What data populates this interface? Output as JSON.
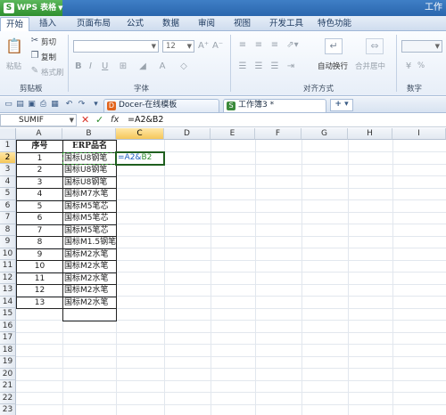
{
  "titlebar": {
    "app_name": "WPS 表格",
    "logo": "S",
    "doc_title": "工作"
  },
  "tabs": [
    "开始",
    "插入",
    "页面布局",
    "公式",
    "数据",
    "审阅",
    "视图",
    "开发工具",
    "特色功能"
  ],
  "ribbon": {
    "paste": "粘贴",
    "cut": "剪切",
    "copy": "复制",
    "format_painter": "格式刷",
    "clipboard_group": "剪贴板",
    "font_size": "12",
    "bold": "B",
    "italic": "I",
    "underline": "U",
    "font_group": "字体",
    "wrap_text": "自动换行",
    "merge_center": "合并居中",
    "align_group": "对齐方式",
    "percent": "%",
    "number_group": "数字"
  },
  "doc_tabs": [
    {
      "label": "Docer-在线模板",
      "active": false
    },
    {
      "label": "工作簿3 *",
      "active": true
    }
  ],
  "formula_bar": {
    "name_box": "SUMIF",
    "cancel": "✕",
    "confirm": "✓",
    "fx": "fx",
    "formula": "=A2&B2"
  },
  "sheet": {
    "columns": [
      "A",
      "B",
      "C",
      "D",
      "E",
      "F",
      "G",
      "H",
      "I"
    ],
    "selected_column": "C",
    "rows": [
      "1",
      "2",
      "3",
      "4",
      "5",
      "6",
      "7",
      "8",
      "9",
      "10",
      "11",
      "12",
      "13",
      "14",
      "15",
      "16",
      "17",
      "18",
      "19",
      "20",
      "21",
      "22",
      "23"
    ],
    "selected_row": "2",
    "header": {
      "a": "序号",
      "b": "ERP品名"
    },
    "data": [
      {
        "a": "1",
        "b": "国标U8钢笔"
      },
      {
        "a": "2",
        "b": "国标U8钢笔"
      },
      {
        "a": "3",
        "b": "国标U8钢笔"
      },
      {
        "a": "4",
        "b": "国标M7水笔"
      },
      {
        "a": "5",
        "b": "国标M5笔芯"
      },
      {
        "a": "6",
        "b": "国标M5笔芯"
      },
      {
        "a": "7",
        "b": "国标M5笔芯"
      },
      {
        "a": "8",
        "b": "国标M1.5钢笔"
      },
      {
        "a": "9",
        "b": "国标M2水笔"
      },
      {
        "a": "10",
        "b": "国标M2水笔"
      },
      {
        "a": "11",
        "b": "国标M2水笔"
      },
      {
        "a": "12",
        "b": "国标M2水笔"
      },
      {
        "a": "13",
        "b": "国标M2水笔"
      }
    ],
    "editing_cell": {
      "prefix": "=A2&",
      "ref2": "B2"
    }
  }
}
